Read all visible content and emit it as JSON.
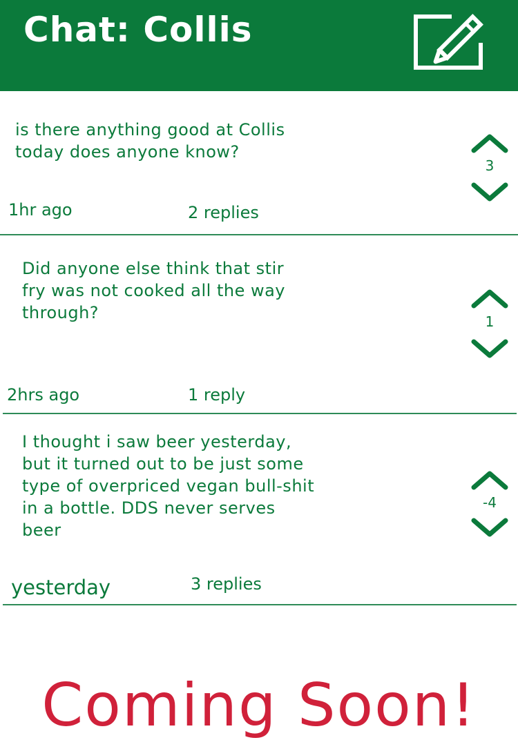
{
  "header": {
    "title": "Chat: Collis",
    "compose_icon": "compose-icon"
  },
  "posts": [
    {
      "text_lines": [
        "is there anything good at Collis",
        "today does anyone know?"
      ],
      "time": "1hr ago",
      "replies": "2 replies",
      "votes": "3"
    },
    {
      "text_lines": [
        "Did anyone else think that stir",
        "fry was not cooked all the way",
        "through?"
      ],
      "time": "2hrs ago",
      "replies": "1 reply",
      "votes": "1"
    },
    {
      "text_lines": [
        "I thought i saw beer yesterday,",
        "but it turned out to be just some",
        "type of overpriced vegan bull-shit",
        "in a bottle.  DDS never serves",
        "beer"
      ],
      "time": "yesterday",
      "replies": "3 replies",
      "votes": "-4"
    }
  ],
  "footer": {
    "banner": "Coming Soon!"
  },
  "colors": {
    "brand_green": "#0b7a3b",
    "banner_red": "#d0213a"
  }
}
